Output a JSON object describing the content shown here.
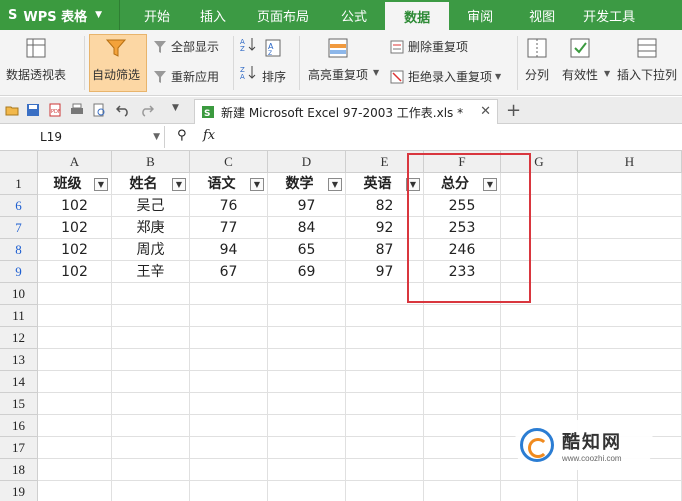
{
  "app": {
    "name": "WPS 表格",
    "logo_glyph": "S"
  },
  "menu": {
    "tabs": [
      {
        "label": "开始"
      },
      {
        "label": "插入"
      },
      {
        "label": "页面布局"
      },
      {
        "label": "公式"
      },
      {
        "label": "数据",
        "active": true
      },
      {
        "label": "审阅"
      },
      {
        "label": "视图"
      },
      {
        "label": "开发工具"
      }
    ]
  },
  "ribbon": {
    "pivot": "数据透视表",
    "autofilter": "自动筛选",
    "show_all": "全部显示",
    "reapply": "重新应用",
    "sort": "排序",
    "highlight_dup": "高亮重复项",
    "remove_dup": "删除重复项",
    "reject_dup": "拒绝录入重复项",
    "split": "分列",
    "validity": "有效性",
    "insert_dropdown": "插入下拉列"
  },
  "document": {
    "tab_title": "新建 Microsoft Excel 97-2003 工作表.xls *"
  },
  "formula_bar": {
    "cell_ref": "L19",
    "fx": "fx"
  },
  "sheet": {
    "columns": [
      "A",
      "B",
      "C",
      "D",
      "E",
      "F",
      "G",
      "H"
    ],
    "header_row": {
      "row": "1",
      "cells": [
        "班级",
        "姓名",
        "语文",
        "数学",
        "英语",
        "总分"
      ]
    },
    "rows": [
      {
        "row": "6",
        "cells": [
          "102",
          "吴己",
          "76",
          "97",
          "82",
          "255"
        ]
      },
      {
        "row": "7",
        "cells": [
          "102",
          "郑庚",
          "77",
          "84",
          "92",
          "253"
        ]
      },
      {
        "row": "8",
        "cells": [
          "102",
          "周戊",
          "94",
          "65",
          "87",
          "246"
        ]
      },
      {
        "row": "9",
        "cells": [
          "102",
          "王辛",
          "67",
          "69",
          "97",
          "233"
        ]
      }
    ],
    "empty_rows": [
      "10",
      "11",
      "12",
      "13",
      "14",
      "15",
      "16",
      "17",
      "18",
      "19"
    ]
  },
  "watermark": {
    "name": "酷知网",
    "url": "www.coozhi.com"
  },
  "colors": {
    "menu_green": "#3c9a44",
    "highlight_red": "#d9363e",
    "filtered_row_blue": "#1e5fd1"
  }
}
